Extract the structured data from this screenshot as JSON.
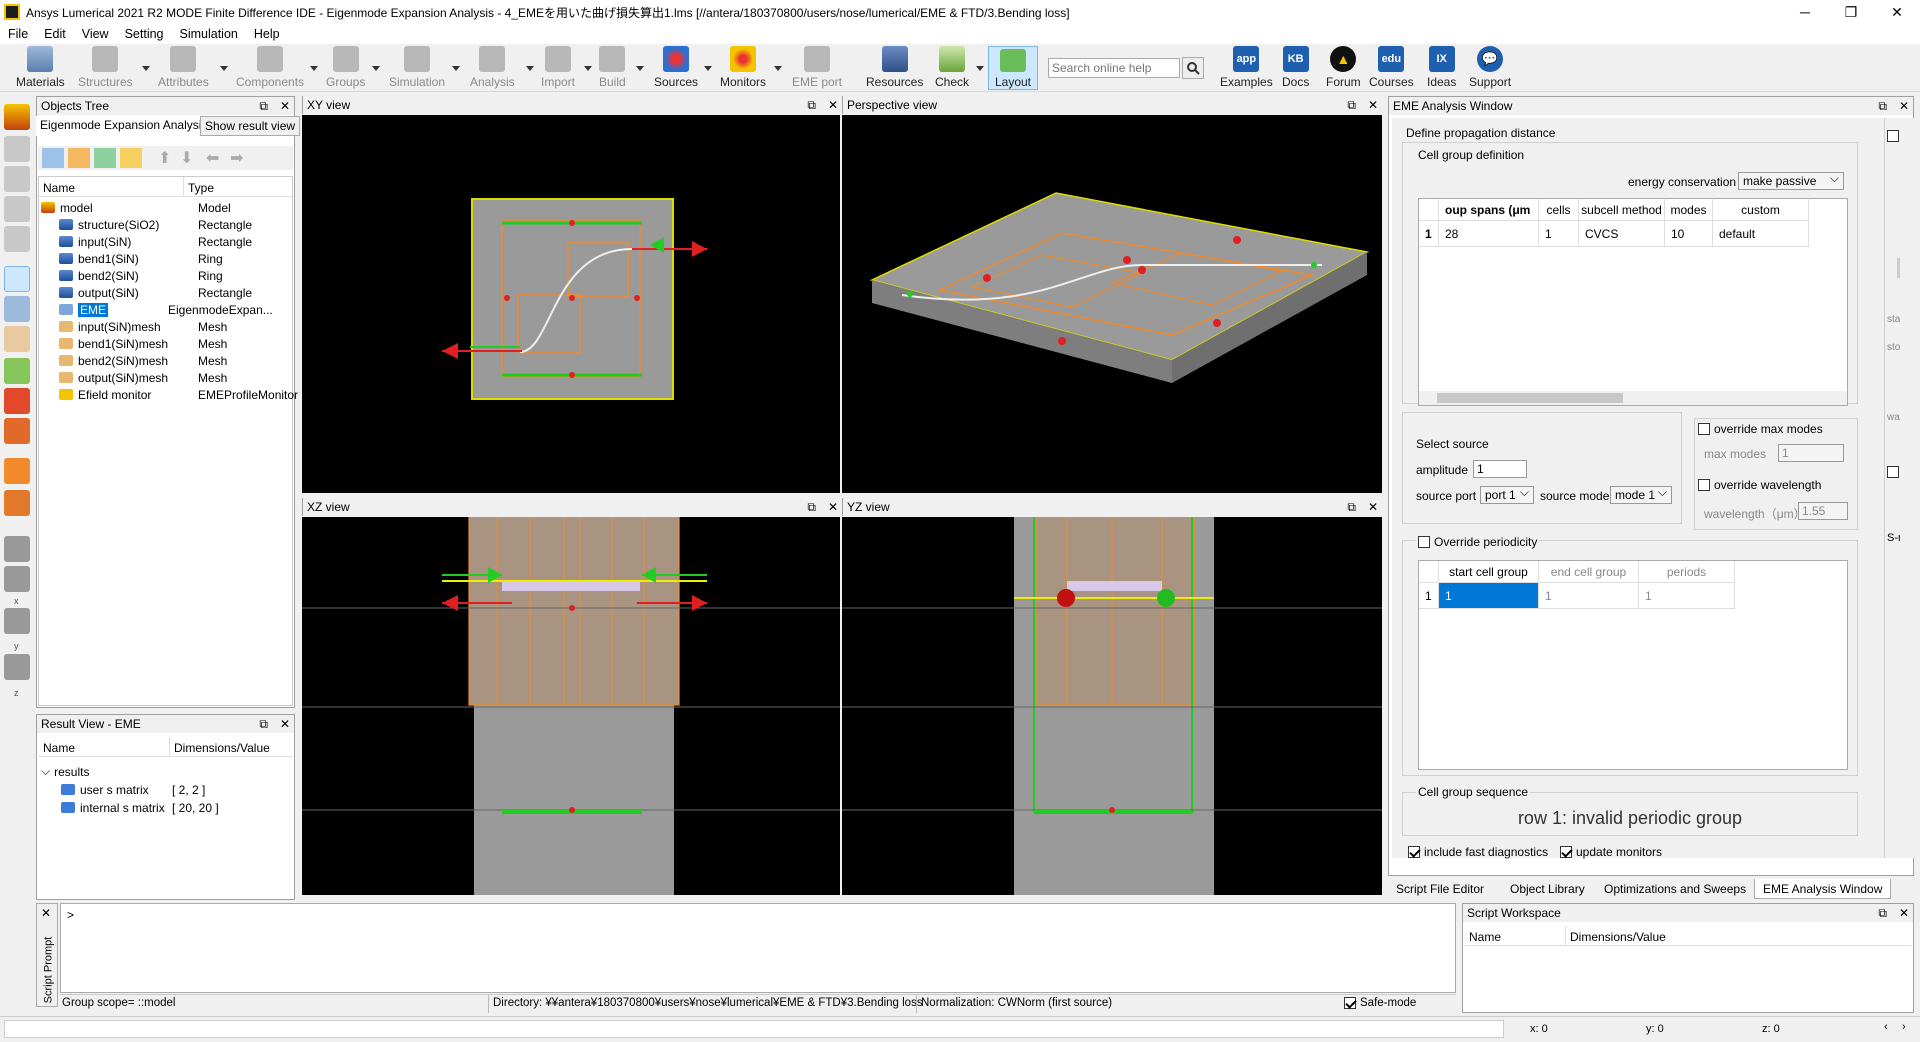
{
  "window": {
    "title": "Ansys Lumerical 2021 R2 MODE Finite Difference IDE - Eigenmode Expansion Analysis - 4_EMEを用いた曲げ損失算出1.lms [//antera/180370800/users/nose/lumerical/EME & FTD/3.Bending loss]"
  },
  "menu": [
    "File",
    "Edit",
    "View",
    "Setting",
    "Simulation",
    "Help"
  ],
  "toolbar": {
    "materials": "Materials",
    "structures": "Structures",
    "attributes": "Attributes",
    "components": "Components",
    "groups": "Groups",
    "simulation": "Simulation",
    "analysis": "Analysis",
    "import": "Import",
    "build": "Build",
    "sources": "Sources",
    "monitors": "Monitors",
    "eme_port": "EME port",
    "resources": "Resources",
    "check": "Check",
    "layout": "Layout",
    "search_placeholder": "Search online help",
    "examples": "Examples",
    "docs": "Docs",
    "forum": "Forum",
    "courses": "Courses",
    "ideas": "Ideas",
    "support": "Support",
    "examples_icon": "app",
    "docs_icon": "KB",
    "courses_icon": "edu",
    "ideas_icon": "IX"
  },
  "objects_tree": {
    "title": "Objects Tree",
    "tab": "Eigenmode Expansion Analysis",
    "show_result": "Show result view",
    "col_name": "Name",
    "col_type": "Type",
    "rows": [
      {
        "name": "model",
        "type": "Model"
      },
      {
        "name": "structure(SiO2)",
        "type": "Rectangle"
      },
      {
        "name": "input(SiN)",
        "type": "Rectangle"
      },
      {
        "name": "bend1(SiN)",
        "type": "Ring"
      },
      {
        "name": "bend2(SiN)",
        "type": "Ring"
      },
      {
        "name": "output(SiN)",
        "type": "Rectangle"
      },
      {
        "name": "EME",
        "type": "EigenmodeExpan..."
      },
      {
        "name": "input(SiN)mesh",
        "type": "Mesh"
      },
      {
        "name": "bend1(SiN)mesh",
        "type": "Mesh"
      },
      {
        "name": "bend2(SiN)mesh",
        "type": "Mesh"
      },
      {
        "name": "output(SiN)mesh",
        "type": "Mesh"
      },
      {
        "name": "Efield monitor",
        "type": "EMEProfileMonitor"
      }
    ]
  },
  "result_view": {
    "title": "Result View - EME",
    "col_name": "Name",
    "col_dim": "Dimensions/Value",
    "group": "results",
    "rows": [
      {
        "name": "user s matrix",
        "value": "[ 2, 2 ]"
      },
      {
        "name": "internal s matrix",
        "value": "[ 20, 20 ]"
      }
    ]
  },
  "views": {
    "xy": "XY view",
    "persp": "Perspective view",
    "xz": "XZ view",
    "yz": "YZ view"
  },
  "eme": {
    "title": "EME Analysis Window",
    "define": "Define propagation distance",
    "cell_group_def": "Cell group definition",
    "energy_label": "energy conservation",
    "energy_value": "make passive",
    "headers": [
      "oup spans (μm",
      "cells",
      "subcell method",
      "modes",
      "custom"
    ],
    "row_idx": "1",
    "row": [
      "28",
      "1",
      "CVCS",
      "10",
      "default"
    ],
    "select_source": "Select source",
    "amplitude_label": "amplitude",
    "amplitude": "1",
    "source_port_label": "source port",
    "source_port": "port 1",
    "source_mode_label": "source mode",
    "source_mode": "mode 1",
    "override_max_modes": "override max modes",
    "max_modes_label": "max modes",
    "max_modes": "1",
    "override_wavelength": "override wavelength",
    "wavelength_label": "wavelength（μm）",
    "wavelength": "1.55",
    "override_periodicity": "Override periodicity",
    "period_headers": [
      "start cell group",
      "end cell group",
      "periods"
    ],
    "period_row": [
      "1",
      "1",
      "1"
    ],
    "cell_seq": "Cell group sequence",
    "seq_msg": "row 1: invalid periodic group",
    "fast_diag": "include fast diagnostics",
    "update_monitors": "update monitors"
  },
  "bottom_tabs": [
    "Script File Editor",
    "Object Library",
    "Optimizations and Sweeps",
    "EME Analysis Window"
  ],
  "script": {
    "prompt_label": "Script Prompt",
    "prompt": ">",
    "workspace": "Script Workspace",
    "col_name": "Name",
    "col_dim": "Dimensions/Value"
  },
  "status": {
    "scope": "Group scope= ::model",
    "directory": "Directory: ¥¥antera¥180370800¥users¥nose¥lumerical¥EME & FTD¥3.Bending loss",
    "normalization": "Normalization: CWNorm (first source)",
    "safe_mode": "Safe-mode",
    "x": "x: 0",
    "y": "y: 0",
    "z": "z: 0"
  },
  "side_labels": {
    "x": "x",
    "y": "y",
    "z": "z",
    "sr": "S-r",
    "sta": "sta",
    "sto": "sto",
    "wa": "wa"
  },
  "colors": {
    "accent": "#0078d7",
    "structure": "#9a9a9a",
    "mesh": "#f08a2c",
    "source_green": "#22cc22",
    "port_red": "#e02020",
    "highlight": "#cce8ff"
  }
}
